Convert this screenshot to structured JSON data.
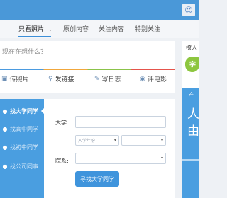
{
  "header": {
    "avatar_icon": "user-icon"
  },
  "tabs": [
    {
      "label": "只看照片",
      "active": true,
      "caret": "⌄"
    },
    {
      "label": "原创内容"
    },
    {
      "label": "关注内容"
    },
    {
      "label": "特别关注"
    }
  ],
  "post": {
    "placeholder": "现在在想什么？",
    "actions": [
      {
        "icon": "camera-icon",
        "glyph": "▣",
        "label": "传照片"
      },
      {
        "icon": "link-icon",
        "glyph": "⚲",
        "label": "发链接"
      },
      {
        "icon": "blog-icon",
        "glyph": "✎",
        "label": "写日志"
      },
      {
        "icon": "movie-icon",
        "glyph": "◉",
        "label": "评电影"
      }
    ]
  },
  "right_panel": {
    "label": "撩人",
    "bubble": "字",
    "banner_small": "产",
    "banner_line1": "人",
    "banner_line2": "由"
  },
  "sidebar": {
    "items": [
      {
        "label": "找大学同学",
        "icon": "●",
        "active": true
      },
      {
        "label": "找高中同学",
        "icon": "●"
      },
      {
        "label": "找初中同学",
        "icon": "●"
      },
      {
        "label": "找公司同事",
        "icon": "●"
      }
    ]
  },
  "form": {
    "university_label": "大学:",
    "enroll_year_placeholder": "入学年份",
    "department_label": "院系:",
    "caret": "▾",
    "submit_label": "寻找大学同学"
  },
  "colors": {
    "accent": "#4a9ee0",
    "button": "#3f94dc"
  }
}
